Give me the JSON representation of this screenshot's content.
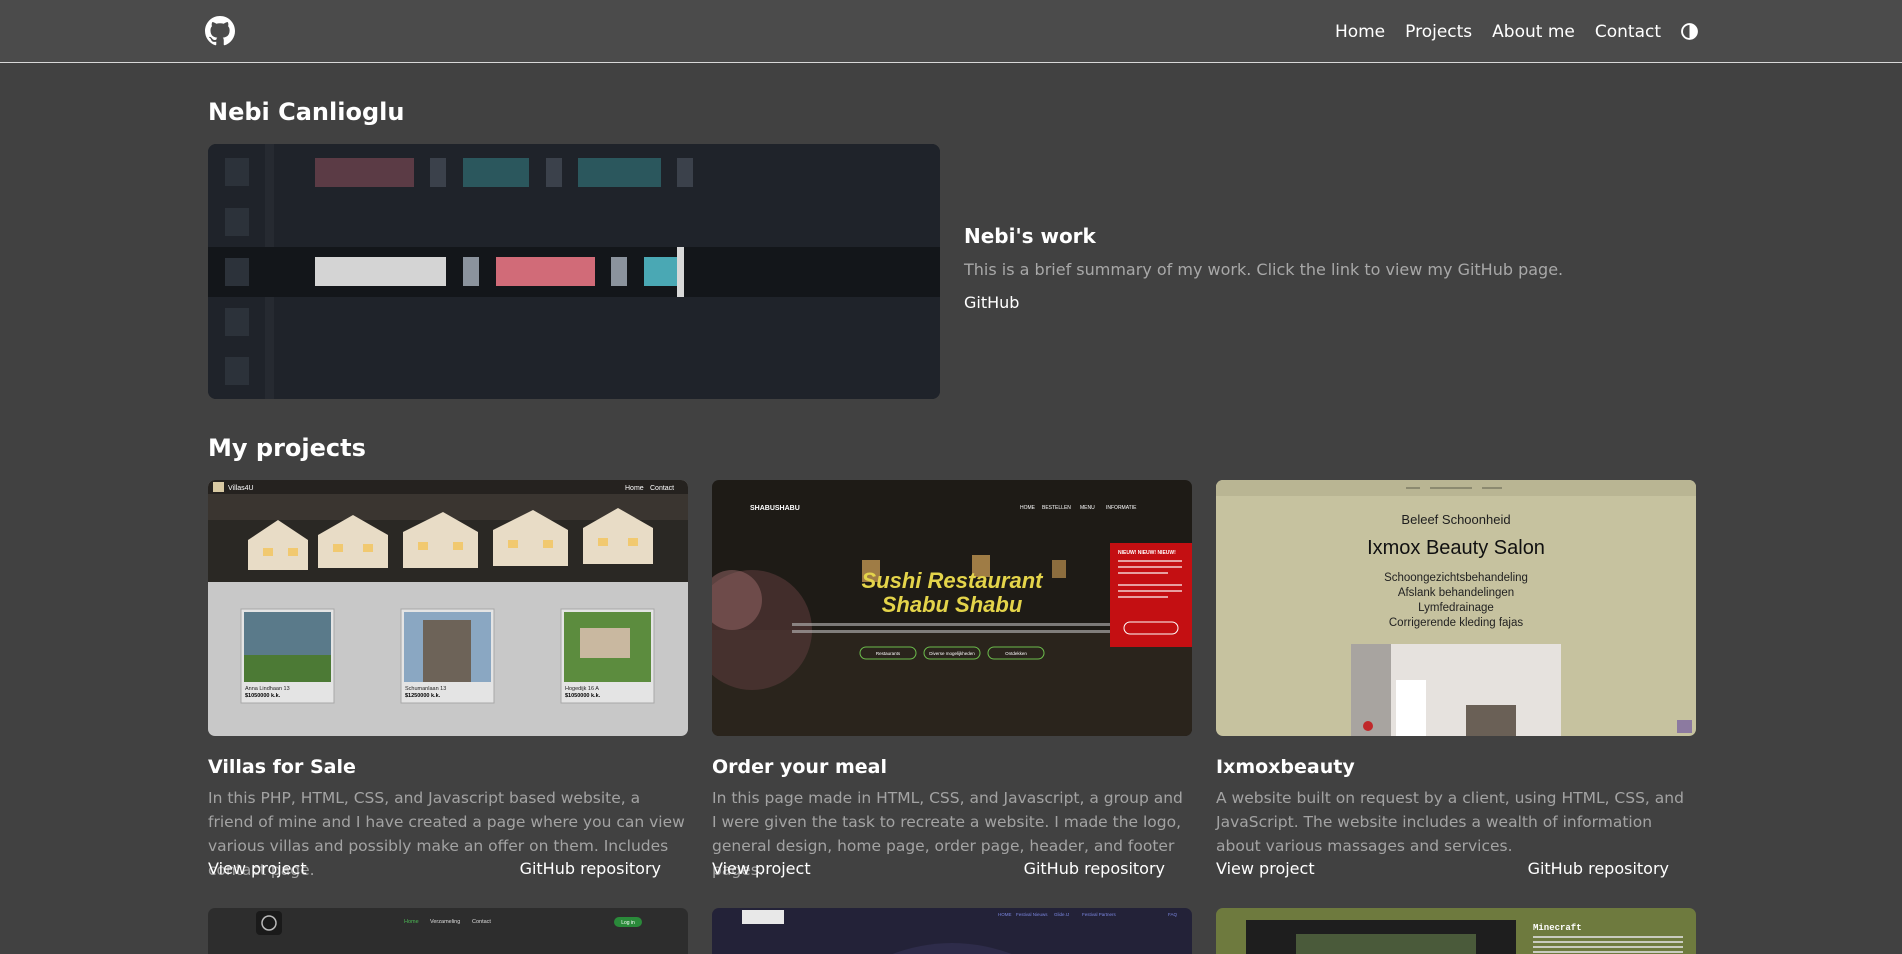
{
  "nav": {
    "logo_icon": "github-icon",
    "links": [
      "Home",
      "Projects",
      "About me",
      "Contact"
    ],
    "theme_icon": "contrast-icon"
  },
  "header": {
    "name": "Nebi Canlioglu",
    "work_title": "Nebi's work",
    "work_summary": "This is a brief summary of my work. Click the link to view my GitHub page.",
    "github_link": "GitHub"
  },
  "projects_section": {
    "title": "My projects",
    "cards": [
      {
        "title": "Villas for Sale",
        "description": "In this PHP, HTML, CSS, and Javascript based website, a friend of mine and I have created a page where you can view various villas and possibly make an offer on them. Includes contact page.",
        "view_label": "View project",
        "repo_label": "GitHub repository",
        "thumb": {
          "brand": "Villas4U",
          "nav": [
            "Home",
            "Contact"
          ],
          "listings": [
            {
              "name": "Anna Lindhaan 13",
              "price": "$1050000 k.k."
            },
            {
              "name": "Schumanlaan 13",
              "price": "$1250000 k.k."
            },
            {
              "name": "Hogedijk 16 A",
              "price": "$1050000 k.k."
            }
          ]
        }
      },
      {
        "title": "Order your meal",
        "description": "In this page made in HTML, CSS, and Javascript, a group and I were given the task to recreate a website. I made the logo, general design, home page, order page, header, and footer pages.",
        "view_label": "View project",
        "repo_label": "GitHub repository",
        "thumb": {
          "brand": "SHABUSHABU",
          "nav": [
            "HOME",
            "BESTELLEN",
            "MENU",
            "INFORMATIE"
          ],
          "headline": "Sushi Restaurant",
          "headline2": "Shabu Shabu",
          "promo": "NIEUW! NIEUW! NIEUW!",
          "buttons": [
            "Restaurants",
            "Diverse mogelijkheden",
            "Ontdekken"
          ]
        }
      },
      {
        "title": "Ixmoxbeauty",
        "description": "A website built on request by a client, using HTML, CSS, and JavaScript. The website includes a wealth of information about various massages and services.",
        "view_label": "View project",
        "repo_label": "GitHub repository",
        "thumb": {
          "subtitle": "Beleef Schoonheid",
          "heading": "Ixmox Beauty Salon",
          "services": [
            "Schoongezichtsbehandeling",
            "Afslank behandelingen",
            "Lymfedrainage",
            "Corrigerende kleding fajas"
          ]
        }
      }
    ],
    "next_row": {
      "thumb4_nav": [
        "Home",
        "Verzameling",
        "Contact"
      ],
      "thumb4_login": "Log in",
      "thumb5_nav": [
        "HOME",
        "Festival Nieuws",
        "Glide.IJ",
        "Festival Partners",
        "FAQ"
      ],
      "thumb6_heading": "Minecraft"
    }
  },
  "colors": {
    "background": "#414141",
    "navbar": "#4b4b4b",
    "muted_text": "#a3a3a3"
  }
}
